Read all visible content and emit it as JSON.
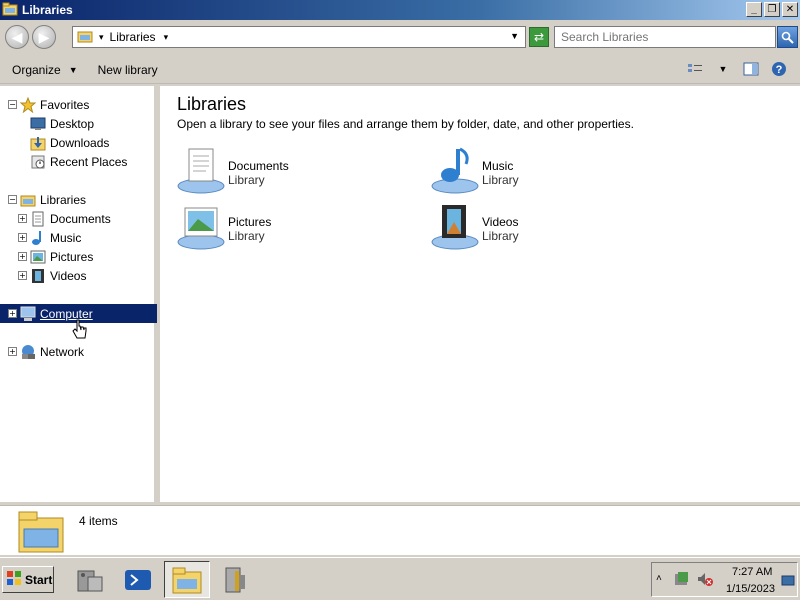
{
  "window": {
    "title": "Libraries"
  },
  "address": {
    "crumb": "Libraries",
    "search_placeholder": "Search Libraries"
  },
  "toolbar": {
    "organize": "Organize",
    "new_library": "New library"
  },
  "nav": {
    "favorites": "Favorites",
    "desktop": "Desktop",
    "downloads": "Downloads",
    "recent": "Recent Places",
    "libraries": "Libraries",
    "documents": "Documents",
    "music": "Music",
    "pictures": "Pictures",
    "videos": "Videos",
    "computer": "Computer",
    "network": "Network"
  },
  "content": {
    "heading": "Libraries",
    "subtitle": "Open a library to see your files and arrange them by folder, date, and other properties.",
    "items": [
      {
        "name": "Documents",
        "type": "Library",
        "icon": "documents-library-icon"
      },
      {
        "name": "Music",
        "type": "Library",
        "icon": "music-library-icon"
      },
      {
        "name": "Pictures",
        "type": "Library",
        "icon": "pictures-library-icon"
      },
      {
        "name": "Videos",
        "type": "Library",
        "icon": "videos-library-icon"
      }
    ]
  },
  "details": {
    "count": "4 items"
  },
  "taskbar": {
    "start": "Start",
    "time": "7:27 AM",
    "date": "1/15/2023"
  },
  "colors": {
    "titlebar": "#0a246a",
    "selection": "#0a246a",
    "chrome": "#d4d0c8"
  }
}
